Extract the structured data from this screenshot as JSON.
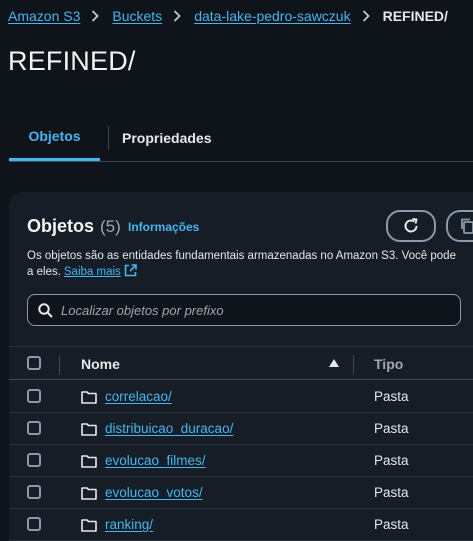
{
  "breadcrumb": {
    "items": [
      "Amazon S3",
      "Buckets",
      "data-lake-pedro-sawczuk"
    ],
    "current": "REFINED/"
  },
  "page": {
    "title": "REFINED/"
  },
  "tabs": [
    {
      "label": "Objetos",
      "active": true
    },
    {
      "label": "Propriedades",
      "active": false
    }
  ],
  "panel": {
    "title": "Objetos",
    "count": "(5)",
    "info_link": "Informações",
    "description_line1": "Os objetos são as entidades fundamentais armazenadas no Amazon S3. Você pode",
    "description_line2": "a eles.",
    "learn_more": "Saiba mais",
    "refresh_icon": "refresh-icon",
    "copy_icon": "copy-icon"
  },
  "search": {
    "placeholder": "Localizar objetos por prefixo",
    "value": ""
  },
  "table": {
    "columns": [
      "Nome",
      "Tipo"
    ],
    "rows": [
      {
        "name": "correlacao/",
        "type": "Pasta"
      },
      {
        "name": "distribuicao_duracao/",
        "type": "Pasta"
      },
      {
        "name": "evolucao_filmes/",
        "type": "Pasta"
      },
      {
        "name": "evolucao_votos/",
        "type": "Pasta"
      },
      {
        "name": "ranking/",
        "type": "Pasta"
      }
    ]
  },
  "colors": {
    "link": "#43b7f0",
    "background": "#0f141a",
    "panel": "#161d26"
  }
}
